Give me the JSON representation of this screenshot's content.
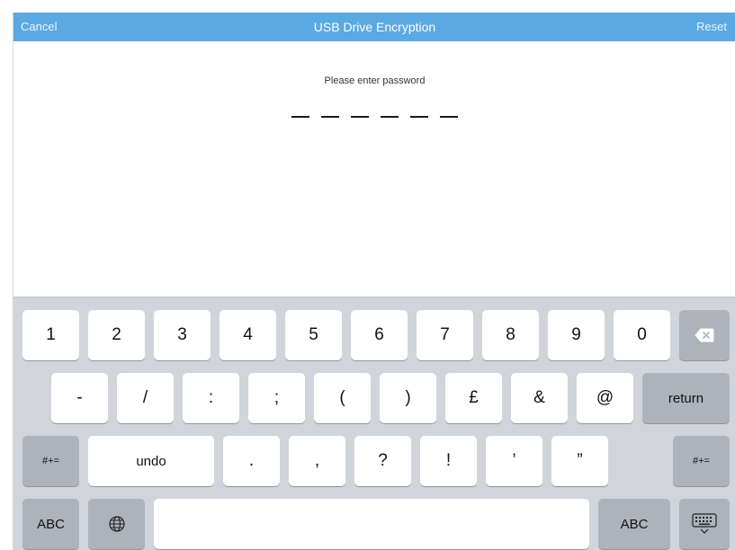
{
  "navbar": {
    "cancel_label": "Cancel",
    "title": "USB Drive Encryption",
    "reset_label": "Reset"
  },
  "prompt": "Please enter password",
  "pin_length": 6,
  "keyboard": {
    "row1": [
      "1",
      "2",
      "3",
      "4",
      "5",
      "6",
      "7",
      "8",
      "9",
      "0"
    ],
    "row2": [
      "-",
      "/",
      ":",
      ";",
      "(",
      ")",
      "£",
      "&",
      "@"
    ],
    "return_label": "return",
    "row3": {
      "symbols_label": "#+=",
      "undo_label": "undo",
      "punct": [
        ".",
        ",",
        "?",
        "!",
        "’",
        "”"
      ],
      "symbols_right_label": "#+="
    },
    "row4": {
      "abc_label": "ABC",
      "abc_right_label": "ABC"
    },
    "icons": [
      "backspace-icon",
      "globe-icon",
      "keyboard-dismiss-icon"
    ]
  },
  "colors": {
    "navbar": "#5aa9e2",
    "keyboard_bg": "#d1d5db",
    "key": "#ffffff",
    "function_key": "#adb3bb"
  }
}
